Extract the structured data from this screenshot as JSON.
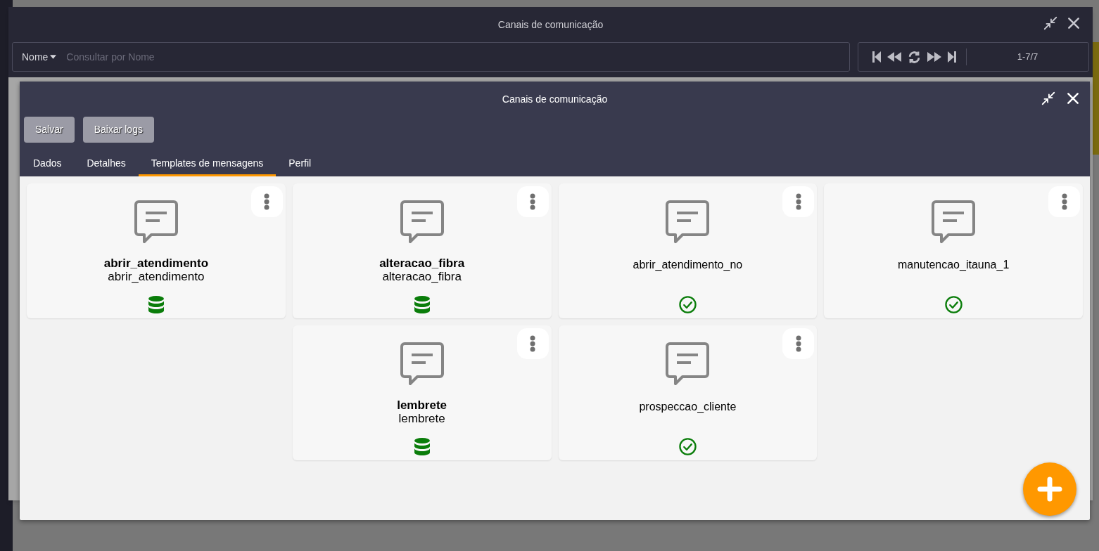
{
  "back_window": {
    "title": "Canais de comunicação",
    "search": {
      "field": "Nome",
      "placeholder": "Consultar por Nome"
    },
    "pager": {
      "range": "1-7/7"
    }
  },
  "window": {
    "title": "Canais de comunicação",
    "buttons": [
      "Salvar",
      "Baixar logs"
    ],
    "tabs": [
      {
        "label": "Dados",
        "selected": false
      },
      {
        "label": "Detalhes",
        "selected": false
      },
      {
        "label": "Templates de mensagens",
        "selected": true
      },
      {
        "label": "Perfil",
        "selected": false
      }
    ],
    "template_rows": [
      [
        {
          "kind": "stored",
          "title": "abrir_atendimento",
          "subtitle": "abrir_atendimento"
        },
        {
          "kind": "stored",
          "title": "alteracao_fibra",
          "subtitle": "alteracao_fibra"
        },
        {
          "kind": "approved",
          "title": "abrir_atendimento_no"
        },
        {
          "kind": "approved",
          "title": "manutencao_itauna_1"
        }
      ],
      [
        {
          "kind": "stored",
          "title": "lembrete",
          "subtitle": "lembrete"
        },
        {
          "kind": "approved",
          "title": "prospeccao_cliente"
        }
      ]
    ]
  }
}
